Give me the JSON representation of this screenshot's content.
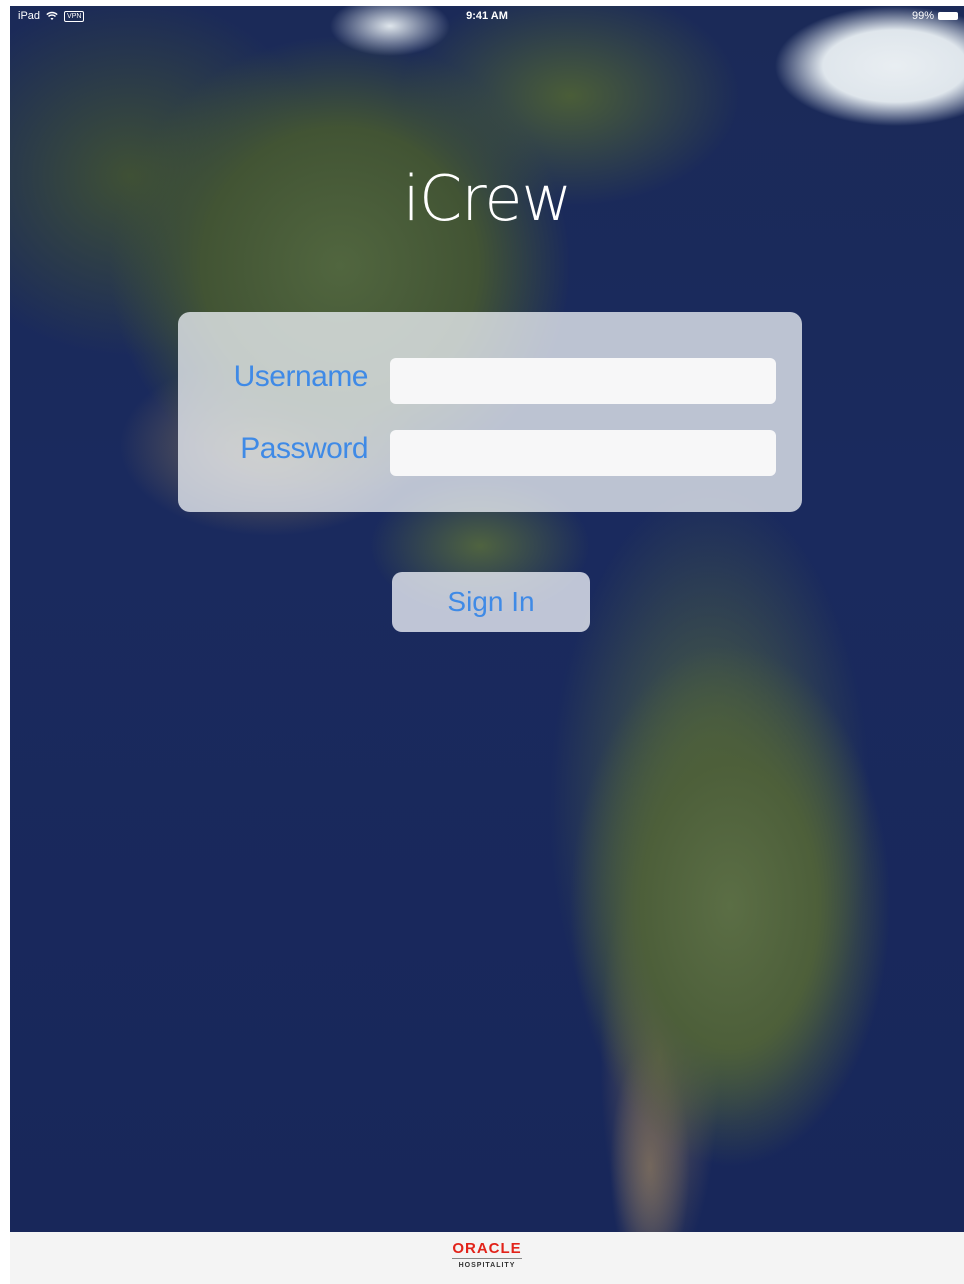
{
  "status_bar": {
    "device": "iPad",
    "vpn": "VPN",
    "time": "9:41 AM",
    "battery_percent": "99%",
    "battery_level": 0.99
  },
  "app": {
    "title": "iCrew"
  },
  "login": {
    "username_label": "Username",
    "username_value": "",
    "password_label": "Password",
    "password_value": "",
    "sign_in_label": "Sign In"
  },
  "footer": {
    "brand": "ORACLE",
    "division": "HOSPITALITY"
  },
  "colors": {
    "accent": "#3f8ae6",
    "brand_red": "#e2231a"
  }
}
